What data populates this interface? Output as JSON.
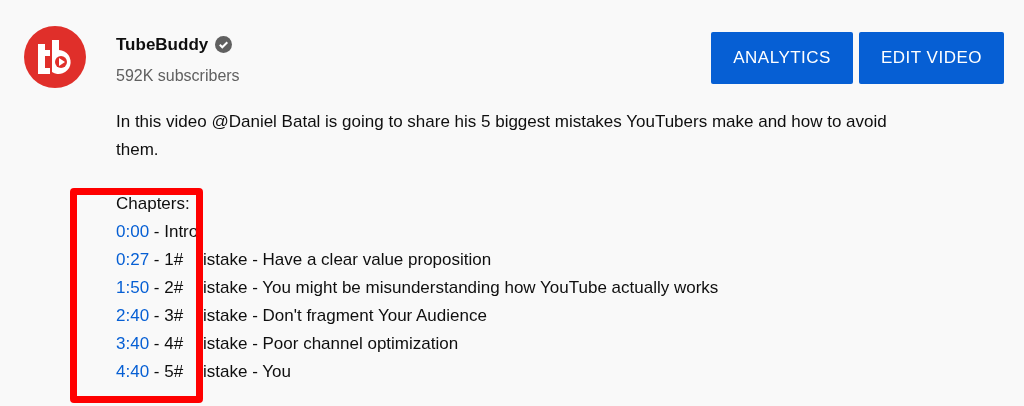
{
  "channel": {
    "name": "TubeBuddy",
    "verified": true,
    "subscribers": "592K subscribers"
  },
  "buttons": [
    "ANALYTICS",
    "EDIT VIDEO"
  ],
  "description": "In this video @Daniel Batal is going to share his 5 biggest mistakes YouTubers make and how to avoid them.",
  "chapters_heading": "Chapters:",
  "chapters": [
    {
      "time": "0:00",
      "title": " - Intro"
    },
    {
      "time": "0:27",
      "title": " - 1#",
      "rest": "istake - Have a clear value proposition"
    },
    {
      "time": "1:50",
      "title": " - 2#",
      "rest": "istake - You might be misunderstanding how YouTube actually works"
    },
    {
      "time": "2:40",
      "title": " - 3#",
      "rest": "istake - Don't fragment Your Audience"
    },
    {
      "time": "3:40",
      "title": " - 4#",
      "rest": "istake - Poor channel optimization"
    },
    {
      "time": "4:40",
      "title": " - 5#",
      "rest": "istake - You"
    }
  ]
}
